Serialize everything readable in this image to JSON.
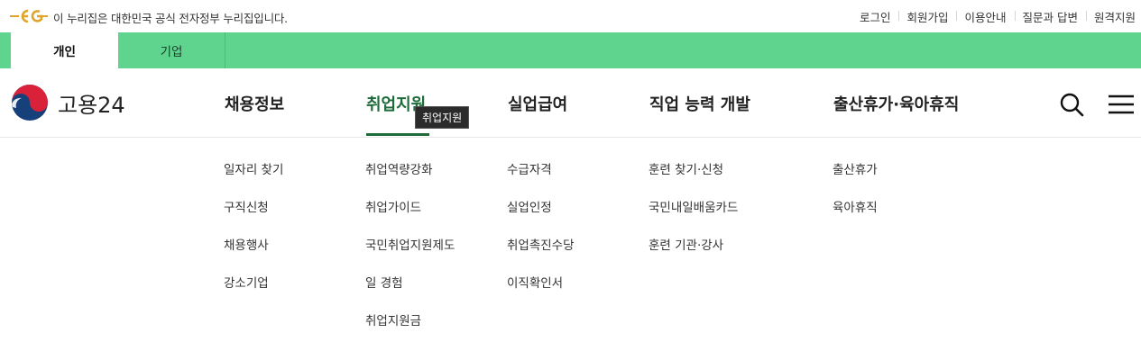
{
  "gov_banner": {
    "text": "이 누리집은 대한민국 공식 전자정부 누리집입니다.",
    "logo_icon": "eg-logo-icon",
    "logo_color": "#e0a42a"
  },
  "util_links": [
    "로그인",
    "회원가입",
    "이용안내",
    "질문과 답변",
    "원격지원"
  ],
  "tabs": [
    {
      "label": "개인",
      "active": true
    },
    {
      "label": "기업",
      "active": false
    }
  ],
  "brand": {
    "name": "고용24",
    "emblem_icon": "taegeuk-emblem-icon"
  },
  "gnb": [
    {
      "label": "채용정보"
    },
    {
      "label": "취업지원",
      "active": true
    },
    {
      "label": "실업급여"
    },
    {
      "label": "직업 능력 개발"
    },
    {
      "label": "출산휴가·육아휴직"
    }
  ],
  "tooltip": "취업지원",
  "submenu": [
    [
      "일자리 찾기",
      "구직신청",
      "채용행사",
      "강소기업"
    ],
    [
      "취업역량강화",
      "취업가이드",
      "국민취업지원제도",
      "일 경험",
      "취업지원금"
    ],
    [
      "수급자격",
      "실업인정",
      "취업촉진수당",
      "이직확인서"
    ],
    [
      "훈련 찾기·신청",
      "국민내일배움카드",
      "훈련 기관·강사"
    ],
    [
      "출산휴가",
      "육아휴직"
    ]
  ],
  "colors": {
    "tab_bar": "#5fd48e",
    "active_nav": "#1e6b3a"
  }
}
